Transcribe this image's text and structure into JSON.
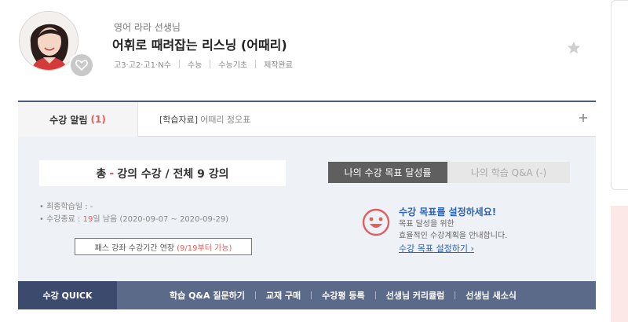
{
  "teacher": {
    "name": "영어 라라 선생님"
  },
  "course": {
    "title": "어휘로 때려잡는 리스닝 (어때리)",
    "tags": [
      "고3·고2·고1·N수",
      "수능",
      "수능기초",
      "제작완료"
    ]
  },
  "notice": {
    "tab_label": "수강 알림",
    "count": "(1)",
    "category": "[학습자료]",
    "text": "어때리 정오표",
    "expand_icon": "plus-icon"
  },
  "progress": {
    "total_prefix": "총",
    "dash": "-",
    "total_text": "강의 수강 / 전체 9 강의",
    "last_study": "최종학습일 : -",
    "end_prefix": "수강종료 :",
    "days_left": "19",
    "end_suffix": "일 남음 (2020-09-07 ~ 2020-09-29)",
    "extend_label": "패스 강좌 수강기간 연장",
    "extend_note": "(9/19부터 가능)"
  },
  "goal": {
    "tab_active": "나의 수강 목표 달성률",
    "tab_qa": "나의 학습 Q&A (-)",
    "title": "수강 목표를 설정하세요!",
    "desc_line1": "목표 달성을 위한",
    "desc_line2": "효율적인 수강계획을 안내합니다.",
    "link": "수강 목표 설정하기 ›"
  },
  "quick": {
    "label": "수강 QUICK",
    "links": [
      "학습 Q&A 질문하기",
      "교재 구매",
      "수강평 등록",
      "선생님 커리큘럼",
      "선생님 새소식"
    ]
  },
  "colors": {
    "accent_red": "#e25d5d",
    "link_blue": "#2b64b5",
    "quick_dark": "#3c4a6e",
    "quick_bar": "#5c6a89"
  }
}
